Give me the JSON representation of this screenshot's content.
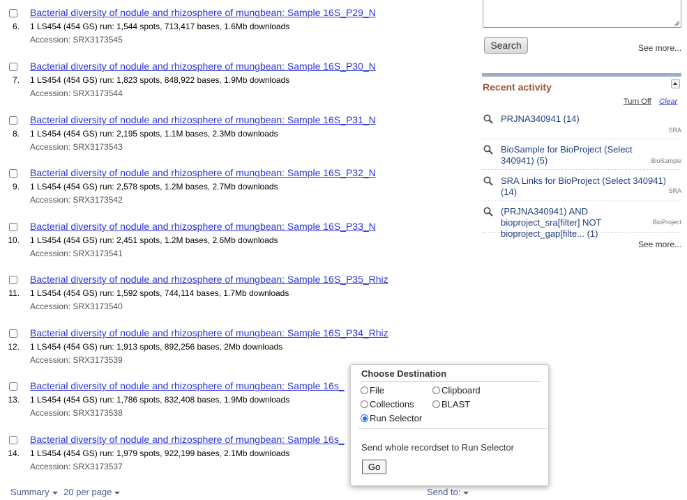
{
  "results": [
    {
      "num": "6.",
      "title": "Bacterial diversity of nodule and rhizosphere of mungbean: Sample 16S_P29_N",
      "desc": "1 LS454 (454 GS) run: 1,544 spots, 713,417 bases, 1.6Mb downloads",
      "accession": "Accession: SRX3173545"
    },
    {
      "num": "7.",
      "title": "Bacterial diversity of nodule and rhizosphere of mungbean: Sample 16S_P30_N",
      "desc": "1 LS454 (454 GS) run: 1,823 spots, 848,922 bases, 1.9Mb downloads",
      "accession": "Accession: SRX3173544"
    },
    {
      "num": "8.",
      "title": "Bacterial diversity of nodule and rhizosphere of mungbean: Sample 16S_P31_N",
      "desc": "1 LS454 (454 GS) run: 2,195 spots, 1.1M bases, 2.3Mb downloads",
      "accession": "Accession: SRX3173543"
    },
    {
      "num": "9.",
      "title": "Bacterial diversity of nodule and rhizosphere of mungbean: Sample 16S_P32_N",
      "desc": "1 LS454 (454 GS) run: 2,578 spots, 1.2M bases, 2.7Mb downloads",
      "accession": "Accession: SRX3173542"
    },
    {
      "num": "10.",
      "title": "Bacterial diversity of nodule and rhizosphere of mungbean: Sample 16S_P33_N",
      "desc": "1 LS454 (454 GS) run: 2,451 spots, 1.2M bases, 2.6Mb downloads",
      "accession": "Accession: SRX3173541"
    },
    {
      "num": "11.",
      "title": "Bacterial diversity of nodule and rhizosphere of mungbean: Sample 16S_P35_Rhiz",
      "desc": "1 LS454 (454 GS) run: 1,592 spots, 744,114 bases, 1.7Mb downloads",
      "accession": "Accession: SRX3173540"
    },
    {
      "num": "12.",
      "title": "Bacterial diversity of nodule and rhizosphere of mungbean: Sample 16S_P34_Rhiz",
      "desc": "1 LS454 (454 GS) run: 1,913 spots, 892,256 bases, 2Mb downloads",
      "accession": "Accession: SRX3173539"
    },
    {
      "num": "13.",
      "title": "Bacterial diversity of nodule and rhizosphere of mungbean: Sample 16s_",
      "desc": "1 LS454 (454 GS) run: 1,786 spots, 832,408 bases, 1.9Mb downloads",
      "accession": "Accession: SRX3173538"
    },
    {
      "num": "14.",
      "title": "Bacterial diversity of nodule and rhizosphere of mungbean: Sample 16s_",
      "desc": "1 LS454 (454 GS) run: 1,979 spots, 922,199 bases, 2.1Mb downloads",
      "accession": "Accession: SRX3173537"
    }
  ],
  "bottom": {
    "summary": "Summary",
    "per_page": "20 per page",
    "send_to": "Send to:"
  },
  "sidebar": {
    "search_label": "Search",
    "see_more": "See more...",
    "recent_title": "Recent activity",
    "turn_off": "Turn Off",
    "clear": "Clear",
    "items": [
      {
        "text": "PRJNA340941 (14)",
        "db": "SRA"
      },
      {
        "text": "BioSample for BioProject (Select 340941) (5)",
        "db": "BioSample"
      },
      {
        "text": "SRA Links for BioProject (Select 340941) (14)",
        "db": "SRA"
      },
      {
        "text": "(PRJNA340941) AND bioproject_sra[filter] NOT bioproject_gap[filte... (1)",
        "db": "BioProject"
      }
    ],
    "see_more_2": "See more..."
  },
  "popup": {
    "title": "Choose Destination",
    "options": {
      "file": "File",
      "clipboard": "Clipboard",
      "collections": "Collections",
      "blast": "BLAST",
      "run_selector": "Run Selector"
    },
    "selected": "run_selector",
    "description": "Send whole recordset to Run Selector",
    "go": "Go"
  },
  "colors": {
    "link": "#2a35d8",
    "accent_title": "#985735",
    "radio_selected": "#1a73e8"
  }
}
